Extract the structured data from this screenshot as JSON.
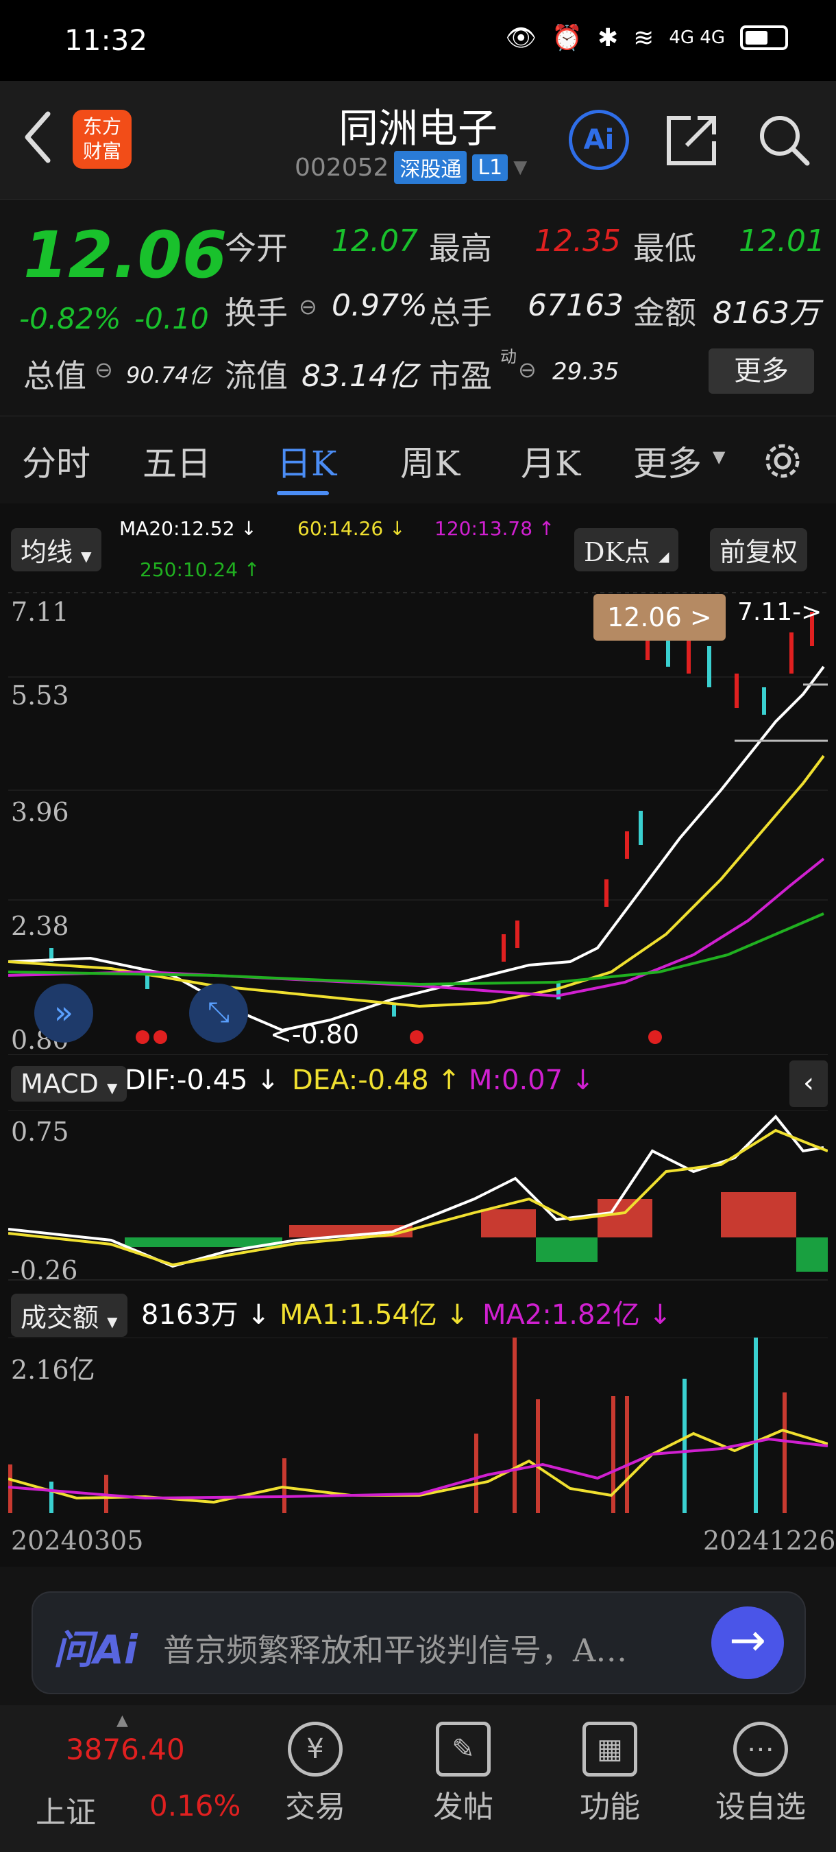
{
  "status_bar": {
    "time": "11:32",
    "network": "4G 4G"
  },
  "header": {
    "logo_text_1": "东方",
    "logo_text_2": "财富",
    "title": "同洲电子",
    "code": "002052",
    "tag_market": "深股通",
    "tag_level": "L1",
    "ai_label": "Ai"
  },
  "quote": {
    "price": "12.06",
    "change_pct": "-0.82%",
    "change_abs": "-0.10",
    "open_label": "今开",
    "open": "12.07",
    "high_label": "最高",
    "high": "12.35",
    "low_label": "最低",
    "low": "12.01",
    "turnover_label": "换手",
    "turnover": "0.97%",
    "volume_label": "总手",
    "volume": "67163",
    "amount_label": "金额",
    "amount": "8163万",
    "mktcap_label": "总值",
    "mktcap": "90.74亿",
    "float_label": "流值",
    "float": "83.14亿",
    "pe_label": "市盈",
    "pe_sup": "动",
    "pe": "29.35",
    "more_label": "更多"
  },
  "tabs": [
    "分时",
    "五日",
    "日K",
    "周K",
    "月K",
    "更多"
  ],
  "chart": {
    "ma_select": "均线",
    "ma20": "MA20:12.52 ↓",
    "ma60": "60:14.26 ↓",
    "ma120": "120:13.78 ↑",
    "ma250": "250:10.24 ↑",
    "dk_label": "DK点",
    "adj_label": "前复权",
    "price_axis": [
      "7.11",
      "5.53",
      "3.96",
      "2.38",
      "0.80"
    ],
    "current_tag": "12.06 >",
    "max_label": "7.11->",
    "min_label": "<-0.80",
    "macd_select": "MACD",
    "dif": "DIF:-0.45 ↓",
    "dea": "DEA:-0.48 ↑",
    "m": "M:0.07 ↓",
    "macd_axis": [
      "0.75",
      "-0.26"
    ],
    "vol_select": "成交额",
    "vol_value": "8163万 ↓",
    "vol_ma1": "MA1:1.54亿 ↓",
    "vol_ma2": "MA2:1.82亿 ↓",
    "vol_axis": "2.16亿",
    "date_start": "20240305",
    "date_end": "20241226"
  },
  "ai_bar": {
    "logo": "问Ai",
    "text": "普京频繁释放和平谈判信号，A…"
  },
  "index": {
    "value": "3876.40",
    "name": "上证",
    "pct": "0.16%"
  },
  "nav": [
    {
      "label": "交易",
      "icon": "yen-icon"
    },
    {
      "label": "发帖",
      "icon": "edit-icon"
    },
    {
      "label": "功能",
      "icon": "apps-icon"
    },
    {
      "label": "设自选",
      "icon": "more-icon"
    }
  ]
}
